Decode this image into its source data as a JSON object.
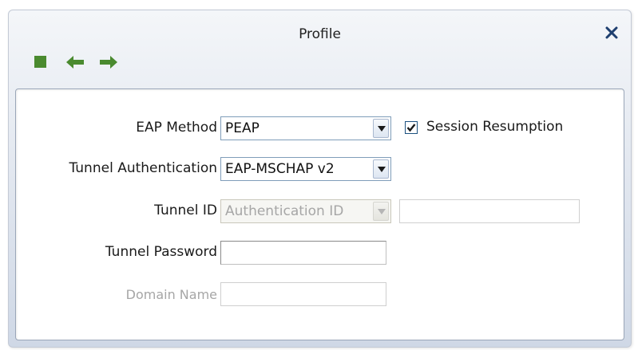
{
  "window": {
    "title": "Profile"
  },
  "toolbar": {
    "icons": [
      "stop-icon",
      "back-arrow-icon",
      "forward-arrow-icon"
    ],
    "icon_color": "#4a8a2f"
  },
  "form": {
    "eap_method": {
      "label": "EAP Method",
      "value": "PEAP"
    },
    "session_resumption": {
      "label": "Session Resumption",
      "checked": true
    },
    "tunnel_authentication": {
      "label": "Tunnel Authentication",
      "value": "EAP-MSCHAP v2"
    },
    "tunnel_id": {
      "label": "Tunnel ID",
      "select_value": "Authentication ID",
      "text_value": ""
    },
    "tunnel_password": {
      "label": "Tunnel Password",
      "value": ""
    },
    "domain_name": {
      "label": "Domain Name",
      "value": ""
    }
  },
  "colors": {
    "accent_green": "#4a8a2f",
    "close_x": "#1f3f6f",
    "disabled_text": "#a6a6a6"
  }
}
